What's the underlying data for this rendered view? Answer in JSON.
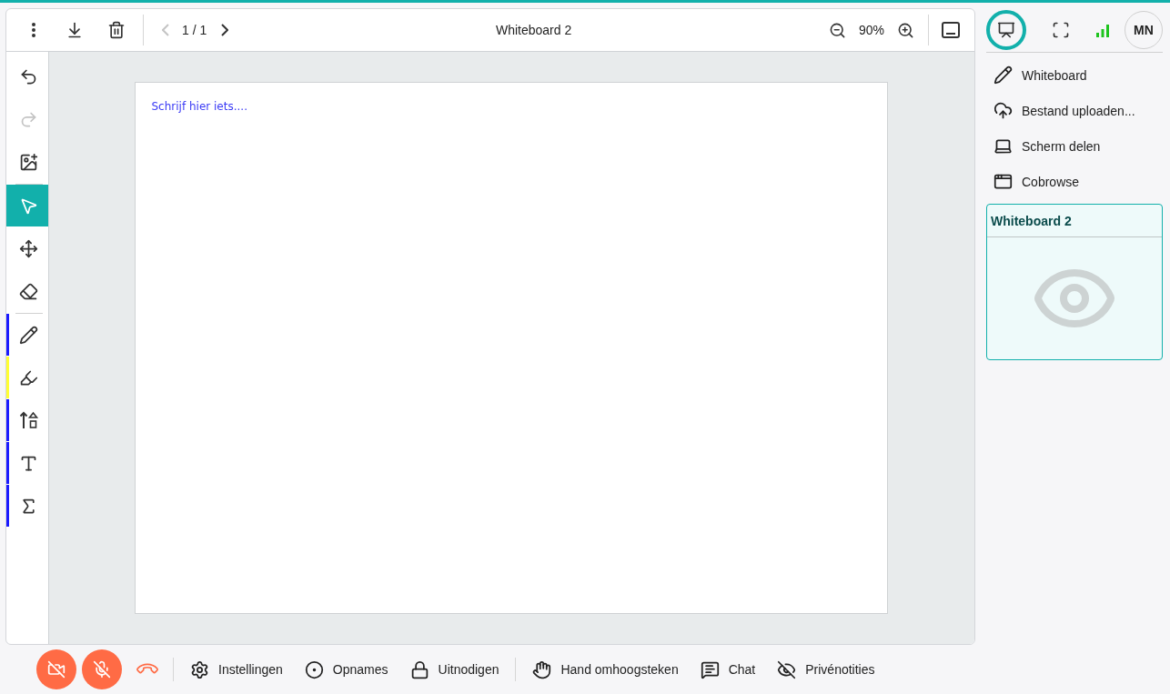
{
  "toolbar": {
    "page_prev": {
      "disabled": true
    },
    "page": "1 / 1",
    "page_next": {
      "disabled": false
    },
    "title": "Whiteboard 2",
    "zoom": "90%"
  },
  "actions": [
    {
      "kind": "undo",
      "disabled": false
    },
    {
      "kind": "redo",
      "disabled": true
    },
    {
      "kind": "add-image",
      "disabled": false
    }
  ],
  "tools": [
    {
      "kind": "select",
      "selected": true
    },
    {
      "kind": "move",
      "selected": false
    },
    {
      "kind": "eraser",
      "selected": false
    }
  ],
  "pens": [
    {
      "kind": "pencil",
      "selected": false,
      "color": "#1a1aff"
    },
    {
      "kind": "highlighter",
      "selected": false,
      "color": "#ffff33"
    },
    {
      "kind": "shapes",
      "selected": false,
      "color": "#1a1aff"
    },
    {
      "kind": "text",
      "selected": false,
      "color": "#1a1aff"
    },
    {
      "kind": "formula",
      "selected": false,
      "color": "#1a1aff"
    }
  ],
  "canvas": {
    "text": "Schrijf hier iets...."
  },
  "top_buttons": [
    {
      "kind": "present",
      "selected": true
    },
    {
      "kind": "fullscreen",
      "selected": false
    }
  ],
  "avatar": "MN",
  "menu": [
    {
      "kind": "whiteboard",
      "label": "Whiteboard"
    },
    {
      "kind": "upload",
      "label": "Bestand uploaden..."
    },
    {
      "kind": "screen",
      "label": "Scherm delen"
    },
    {
      "kind": "cobrowse",
      "label": "Cobrowse"
    }
  ],
  "card": {
    "title": "Whiteboard 2"
  },
  "media": [
    {
      "kind": "camera",
      "on": false
    },
    {
      "kind": "microphone",
      "on": false
    }
  ],
  "bottom": [
    {
      "kind": "settings",
      "label": "Instellingen"
    },
    {
      "kind": "record",
      "label": "Opnames"
    },
    {
      "kind": "invite",
      "label": "Uitnodigen"
    },
    {
      "kind": "hand",
      "label": "Hand omhoogsteken"
    },
    {
      "kind": "chat",
      "label": "Chat"
    },
    {
      "kind": "notes",
      "label": "Privénotities"
    }
  ]
}
